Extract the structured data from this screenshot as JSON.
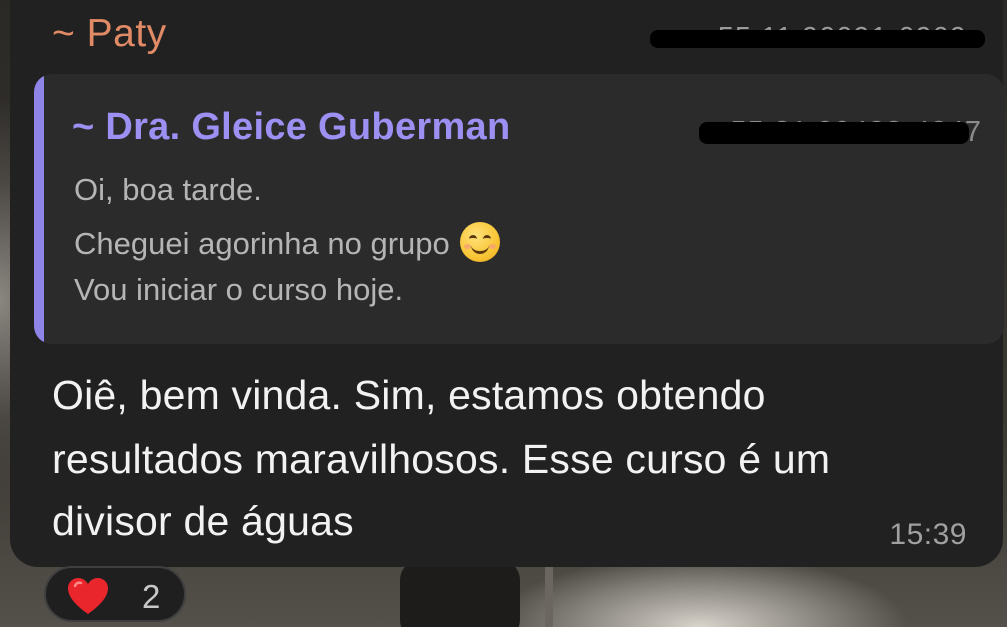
{
  "message": {
    "sender_name": "~ Paty",
    "sender_phone": "+55 11 90091-0909",
    "quoted": {
      "author": "~ Dra. Gleice Guberman",
      "phone": "+55 21 99432-4247",
      "lines": [
        "Oi, boa tarde.",
        "Cheguei agorinha no grupo",
        "Vou iniciar o curso hoje."
      ],
      "emoji": "smiling-face-emoji"
    },
    "body_lines": [
      "Oiê, bem vinda. Sim, estamos obtendo",
      "resultados maravilhosos. Esse curso é um",
      "divisor de águas"
    ],
    "time": "15:39"
  },
  "reaction": {
    "icon": "heart-icon",
    "count": "2"
  },
  "colors": {
    "bubble": "#212121",
    "sender": "#e08a66",
    "quote_accent": "#8f84e8",
    "quote_author": "#9c90f3",
    "heart": "#e8262c"
  }
}
